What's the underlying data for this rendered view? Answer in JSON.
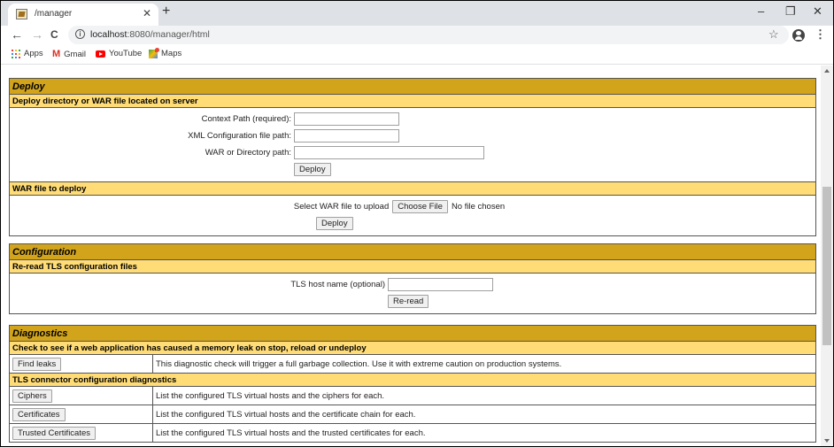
{
  "browser": {
    "tab": {
      "title": "/manager",
      "favicon": "tomcat-favicon"
    },
    "window_controls": {
      "minimize": "–",
      "restore": "❐",
      "close": "✕"
    },
    "nav": {
      "back": "←",
      "forward": "→",
      "reload": "C"
    },
    "url": {
      "host": "localhost",
      "rest": ":8080/manager/html"
    },
    "bookmarks": [
      {
        "label": "Apps",
        "icon": "apps-grid-icon"
      },
      {
        "label": "Gmail",
        "icon": "gmail-icon"
      },
      {
        "label": "YouTube",
        "icon": "youtube-icon"
      },
      {
        "label": "Maps",
        "icon": "maps-icon"
      }
    ]
  },
  "deploy": {
    "title": "Deploy",
    "server_section": {
      "heading": "Deploy directory or WAR file located on server",
      "fields": [
        {
          "label": "Context Path (required):",
          "value": ""
        },
        {
          "label": "XML Configuration file path:",
          "value": ""
        },
        {
          "label": "WAR or Directory path:",
          "value": ""
        }
      ],
      "button": "Deploy"
    },
    "upload_section": {
      "heading": "WAR file to deploy",
      "label": "Select WAR file to upload",
      "choose_button": "Choose File",
      "file_status": "No file chosen",
      "button": "Deploy"
    }
  },
  "configuration": {
    "title": "Configuration",
    "heading": "Re-read TLS configuration files",
    "field_label": "TLS host name (optional)",
    "field_value": "",
    "button": "Re-read"
  },
  "diagnostics": {
    "title": "Diagnostics",
    "leak_heading": "Check to see if a web application has caused a memory leak on stop, reload or undeploy",
    "leak_row": {
      "button": "Find leaks",
      "description": "This diagnostic check will trigger a full garbage collection. Use it with extreme caution on production systems."
    },
    "tls_heading": "TLS connector configuration diagnostics",
    "tls_rows": [
      {
        "button": "Ciphers",
        "description": "List the configured TLS virtual hosts and the ciphers for each."
      },
      {
        "button": "Certificates",
        "description": "List the configured TLS virtual hosts and the certificate chain for each."
      },
      {
        "button": "Trusted Certificates",
        "description": "List the configured TLS virtual hosts and the trusted certificates for each."
      }
    ]
  },
  "scrollbar": {
    "position_fraction": 0.55,
    "visible_fraction": 0.44
  },
  "colors": {
    "title_bar": "#d2a41c",
    "sub_bar": "#ffdc75",
    "border": "#555555"
  }
}
